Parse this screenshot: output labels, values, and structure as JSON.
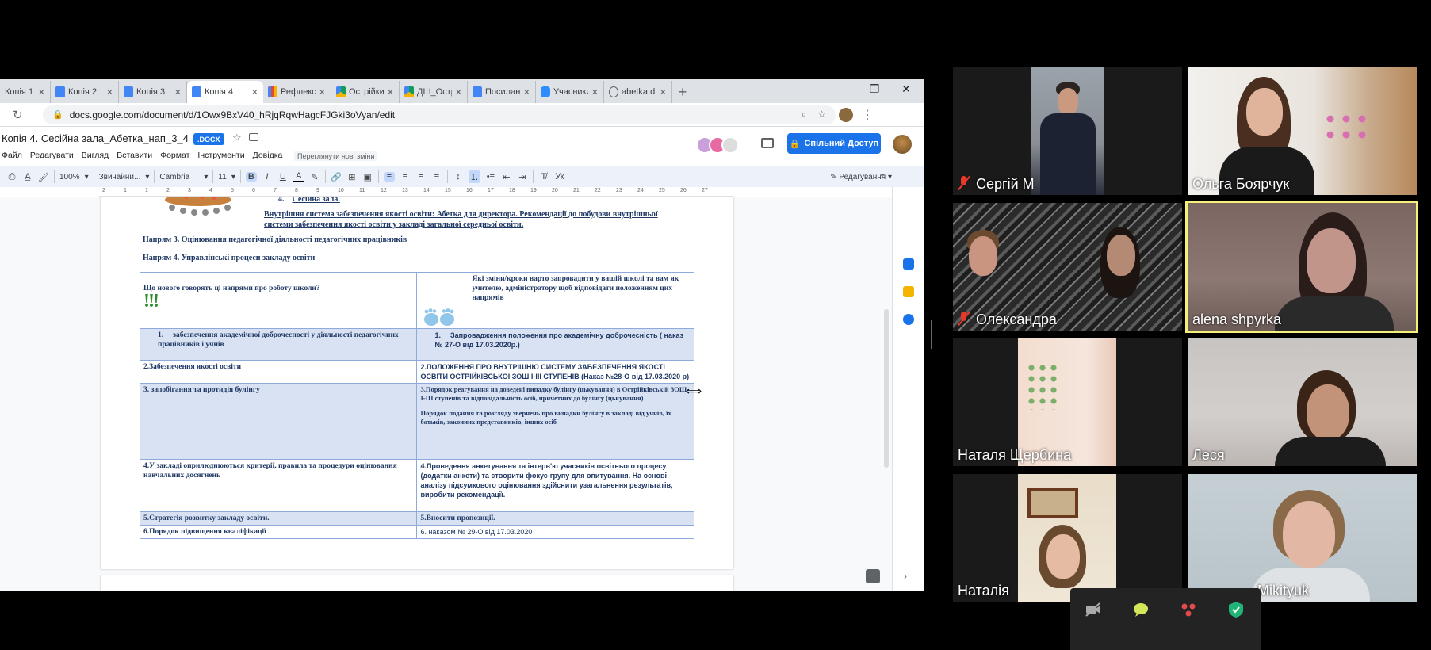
{
  "browser": {
    "tabs": [
      {
        "title": "Копія 1",
        "icon": "docs-icon",
        "color": "#4285f4"
      },
      {
        "title": "Копія 2",
        "icon": "docs-icon",
        "color": "#4285f4"
      },
      {
        "title": "Копія 3",
        "icon": "docs-icon",
        "color": "#4285f4"
      },
      {
        "title": "Копія 4",
        "icon": "docs-icon",
        "color": "#4285f4",
        "active": true
      },
      {
        "title": "Рефлексія",
        "icon": "forms-chart-icon",
        "color": "#e8453c"
      },
      {
        "title": "Острійки",
        "icon": "drive-icon",
        "color": "#0f9d58"
      },
      {
        "title": "ДШ_Острійки",
        "icon": "drive-icon",
        "color": "#f4b400"
      },
      {
        "title": "Посилання",
        "icon": "docs-icon",
        "color": "#4285f4"
      },
      {
        "title": "Учасники",
        "icon": "zoom-icon",
        "color": "#2d8cff"
      },
      {
        "title": "abetka d",
        "icon": "globe-icon",
        "color": "#5f6368"
      }
    ],
    "url": "docs.google.com/document/d/1Owx9BxV40_hRjqRqwHagcFJGki3oVyan/edit"
  },
  "docs": {
    "title": "Копія 4. Сесійна зала_Абетка_нап_3_4",
    "badge": ".DOCX",
    "menu": [
      "Файл",
      "Редагувати",
      "Вигляд",
      "Вставити",
      "Формат",
      "Інструменти",
      "Довідка"
    ],
    "last_edit": "Переглянути нові зміни",
    "share_label": "Спільний Доступ",
    "toolbar": {
      "zoom": "100%",
      "style": "Звичайни...",
      "font": "Cambria",
      "size": "11",
      "bold": "B",
      "italic": "I",
      "underline": "U",
      "text_color": "A",
      "mode": "Редагування"
    },
    "ruler": [
      "2",
      "1",
      "1",
      "2",
      "3",
      "4",
      "5",
      "6",
      "7",
      "8",
      "9",
      "10",
      "11",
      "12",
      "13",
      "14",
      "15",
      "16",
      "17",
      "18",
      "19",
      "20",
      "21",
      "22",
      "23",
      "24",
      "25",
      "26",
      "27"
    ]
  },
  "document": {
    "item4": {
      "num": "4.",
      "text": "Сесійна зала."
    },
    "link": "Внутрішня система забезпечення якості освіти: Абетка для директора. Рекомендації до побудови внутрішньої системи забезпечення якості освіти у закладі загальної середньої освіти.",
    "dir3": "Напрям 3. Оцінювання педагогічної діяльності педагогічних працівників",
    "dir4": "Напрям 4. Управлінські процеси закладу освіти",
    "table": {
      "head_left": "Що нового говорять ці напрями про роботу школи?",
      "head_left_marks": "!!!",
      "head_right": "Які зміни/кроки варто запровадити у вашій школі та вам як учителю, адміністратору щоб відповідати положенням цих напрямів",
      "rows": [
        {
          "left": "забезпечення академічної доброчесності у діяльності педагогічних працівників і учнів",
          "left_num": "1.",
          "right": "Запровадження положення про академічну доброчесність ( наказ № 27-О від 17.03.2020р.)",
          "right_num": "1.",
          "hl": true
        },
        {
          "left": "2.Забезпечення якості освіти",
          "right": "2.ПОЛОЖЕННЯ ПРО ВНУТРІШНЮ СИСТЕМУ ЗАБЕЗПЕЧЕННЯ ЯКОСТІ ОСВІТИ ОСТРІЙКІВСЬКОЇ ЗОШ І-ІІІ СТУПЕНІВ (Наказ №28-О від 17.03.2020 р)",
          "hl": false
        },
        {
          "left": "3. запобігання та протидія булінгу",
          "right": "3.Порядок реагування на доведені випадку булінгу (цькування) в Острійківській ЗОШ І-ІІІ ступенів та відповідальність осіб, причетних до булінгу (цькування)",
          "right2": "Порядок подання та розгляду звернень про випадки булінгу в закладі від учнів, їх батьків, законних представників, інших осіб",
          "hl": true
        },
        {
          "left": "4.У закладі оприлюднюються критерії, правила та процедури оцінювання навчальних досягнень",
          "right": "4.Проведення анкетування та інтерв'ю учасників освітнього процесу (додатки анкети) та створити фокус-групу для опитування. На основі аналізу підсумкового оцінювання здійснити узагальнення результатів, виробити рекомендації.",
          "hl": false
        },
        {
          "left": "5.Стратегія розвитку закладу освіти.",
          "right": "5.Вносити пропозиції.",
          "hl": true
        },
        {
          "left": "6.Порядок підвищення кваліфікації",
          "right": "6. наказом № 29-О від 17.03.2020",
          "hl": false
        }
      ]
    }
  },
  "participants": [
    {
      "name": "Сергій М",
      "muted": true
    },
    {
      "name": "Ольга Боярчук",
      "muted": false
    },
    {
      "name": "Олександра",
      "muted": true
    },
    {
      "name": "alena shpyrka",
      "muted": false,
      "speaking": true
    },
    {
      "name": "Наталя Щербина",
      "muted": false
    },
    {
      "name": "Леся",
      "muted": false
    },
    {
      "name": "Наталія",
      "muted": false
    },
    {
      "name": "Mikityuk",
      "muted": true
    }
  ],
  "colors": {
    "active_speaker": "#f5f07a",
    "mute_red": "#e8382b",
    "docs_blue": "#1a73e8",
    "doc_text": "#1f3864",
    "table_highlight": "#d9e2f3"
  }
}
